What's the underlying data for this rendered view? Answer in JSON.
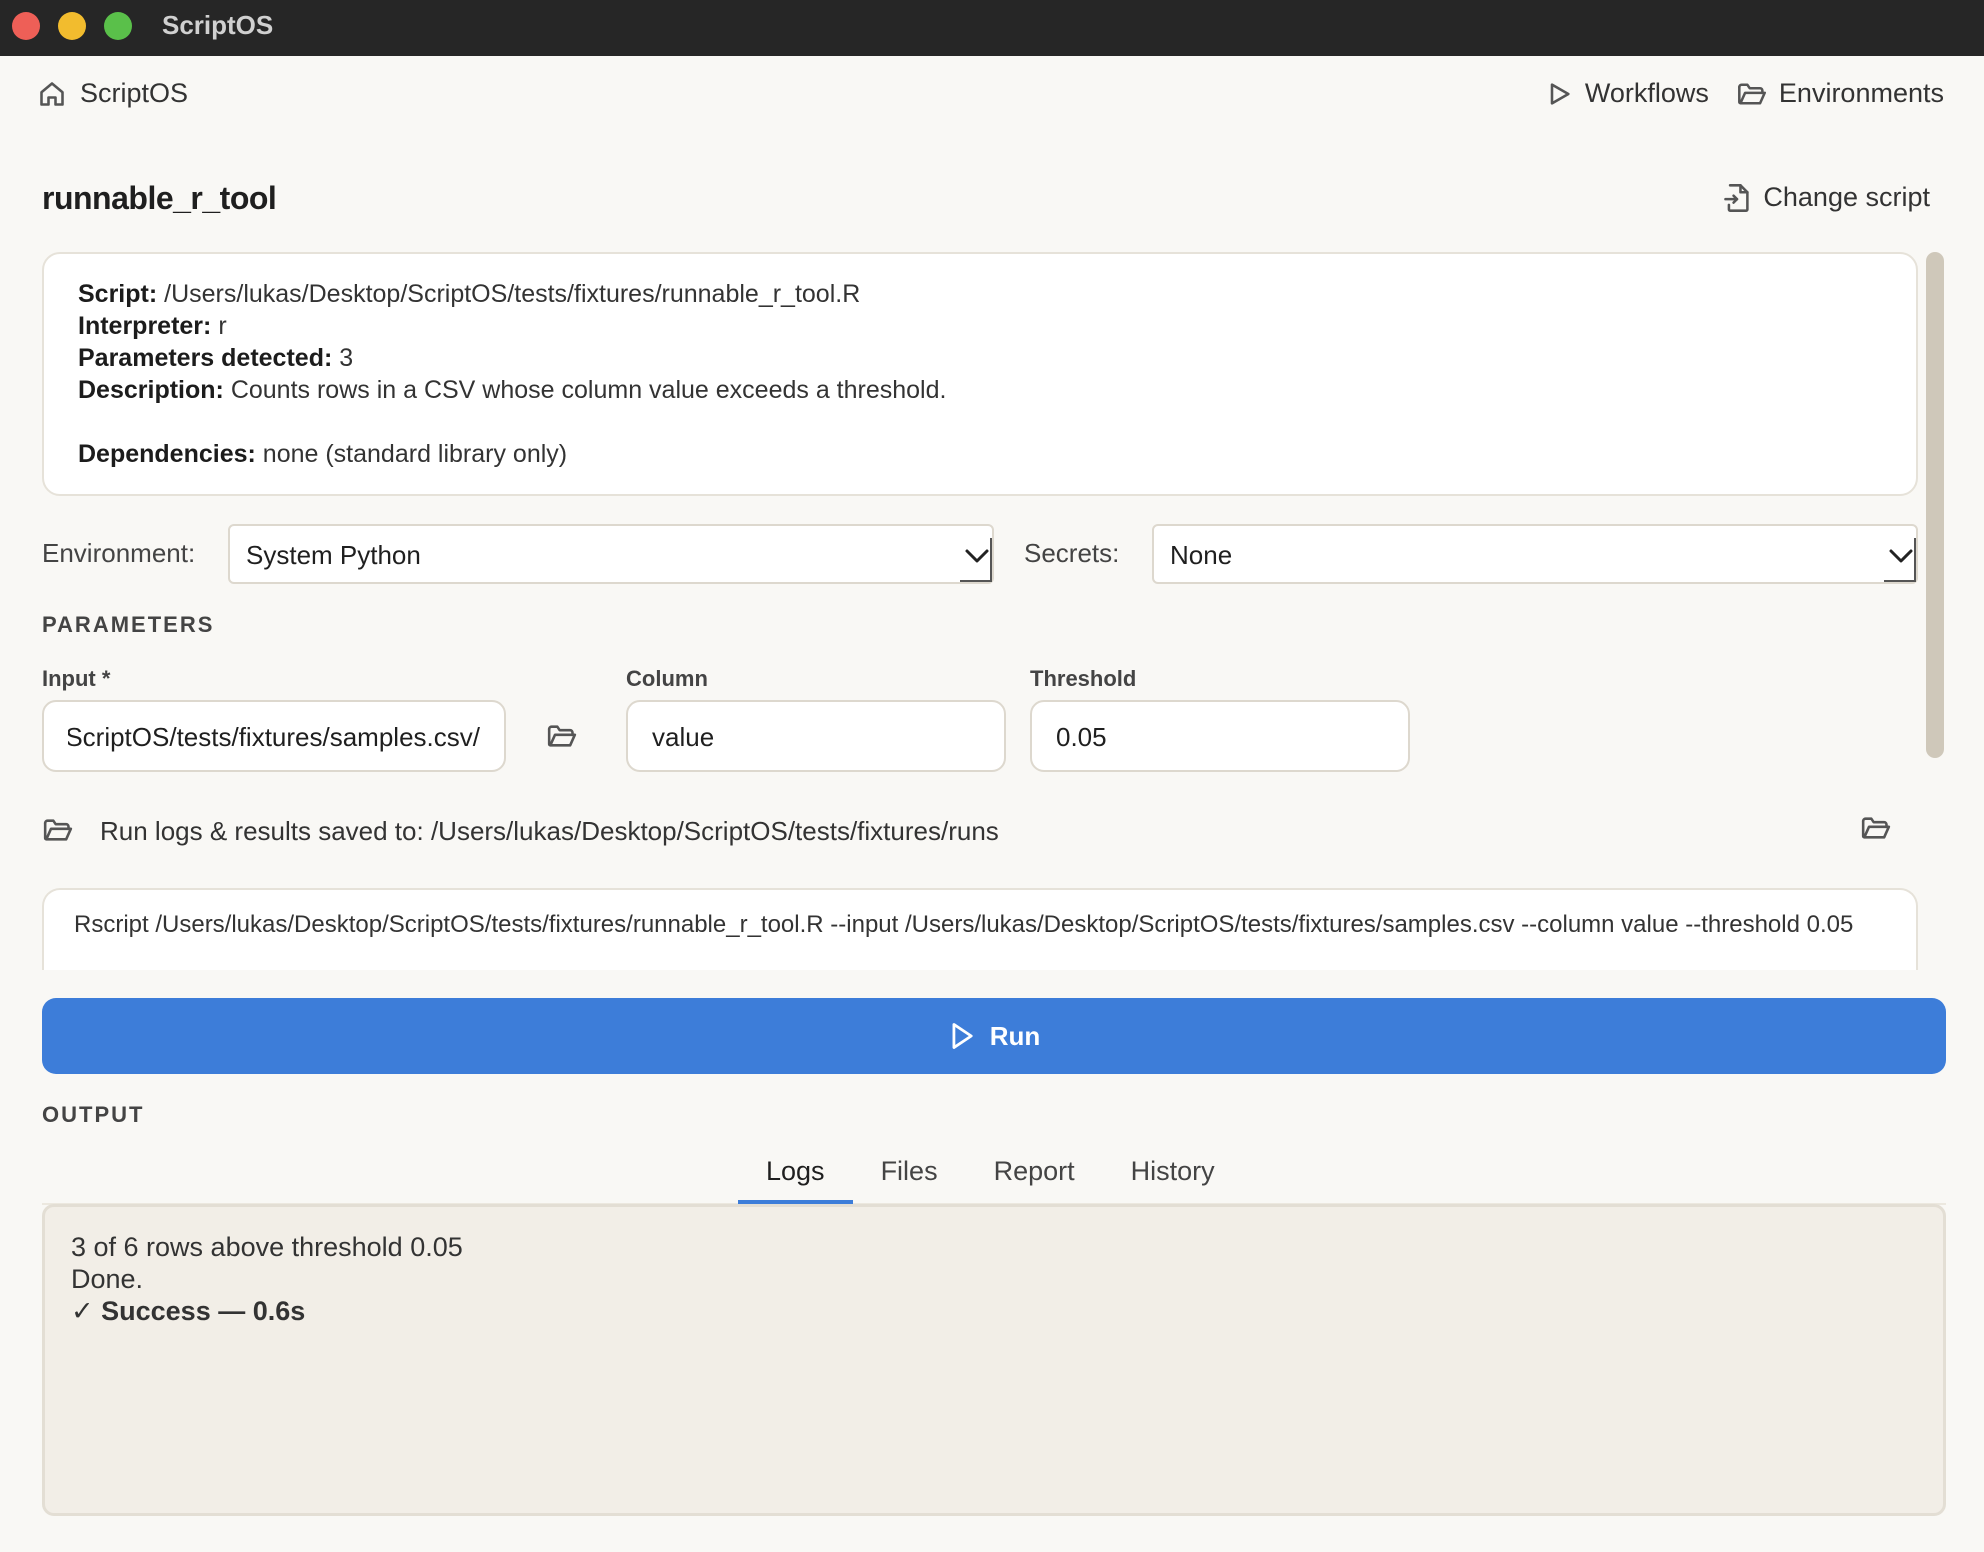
{
  "window": {
    "title": "ScriptOS"
  },
  "nav": {
    "home": "ScriptOS",
    "workflows": "Workflows",
    "environments": "Environments"
  },
  "page": {
    "title": "runnable_r_tool",
    "change_script": "Change script"
  },
  "info": {
    "script_label": "Script:",
    "script_value": "/Users/lukas/Desktop/ScriptOS/tests/fixtures/runnable_r_tool.R",
    "interpreter_label": "Interpreter:",
    "interpreter_value": "r",
    "params_label": "Parameters detected:",
    "params_value": "3",
    "description_label": "Description:",
    "description_value": "Counts rows in a CSV whose column value exceeds a threshold.",
    "deps_label": "Dependencies:",
    "deps_value": "none (standard library only)"
  },
  "env": {
    "environment_label": "Environment:",
    "environment_value": "System Python",
    "secrets_label": "Secrets:",
    "secrets_value": "None"
  },
  "parameters": {
    "section": "PARAMETERS",
    "input_label": "Input *",
    "input_value": "/Users/lukas/Desktop/ScriptOS/tests/fixtures/samples.csv",
    "column_label": "Column",
    "column_value": "value",
    "threshold_label": "Threshold",
    "threshold_value": "0.05"
  },
  "logs_path": "Run logs & results saved to: /Users/lukas/Desktop/ScriptOS/tests/fixtures/runs",
  "command": "Rscript /Users/lukas/Desktop/ScriptOS/tests/fixtures/runnable_r_tool.R --input /Users/lukas/Desktop/ScriptOS/tests/fixtures/samples.csv --column value --threshold 0.05",
  "run_label": "Run",
  "output": {
    "section": "OUTPUT",
    "tabs": [
      "Logs",
      "Files",
      "Report",
      "History"
    ],
    "active_tab": "Logs",
    "lines": [
      "3 of 6 rows above threshold 0.05",
      "Done."
    ],
    "success": "✓ Success — 0.6s"
  },
  "colors": {
    "accent": "#3d7dd9",
    "titlebar": "#262626",
    "background": "#f9f8f5"
  }
}
